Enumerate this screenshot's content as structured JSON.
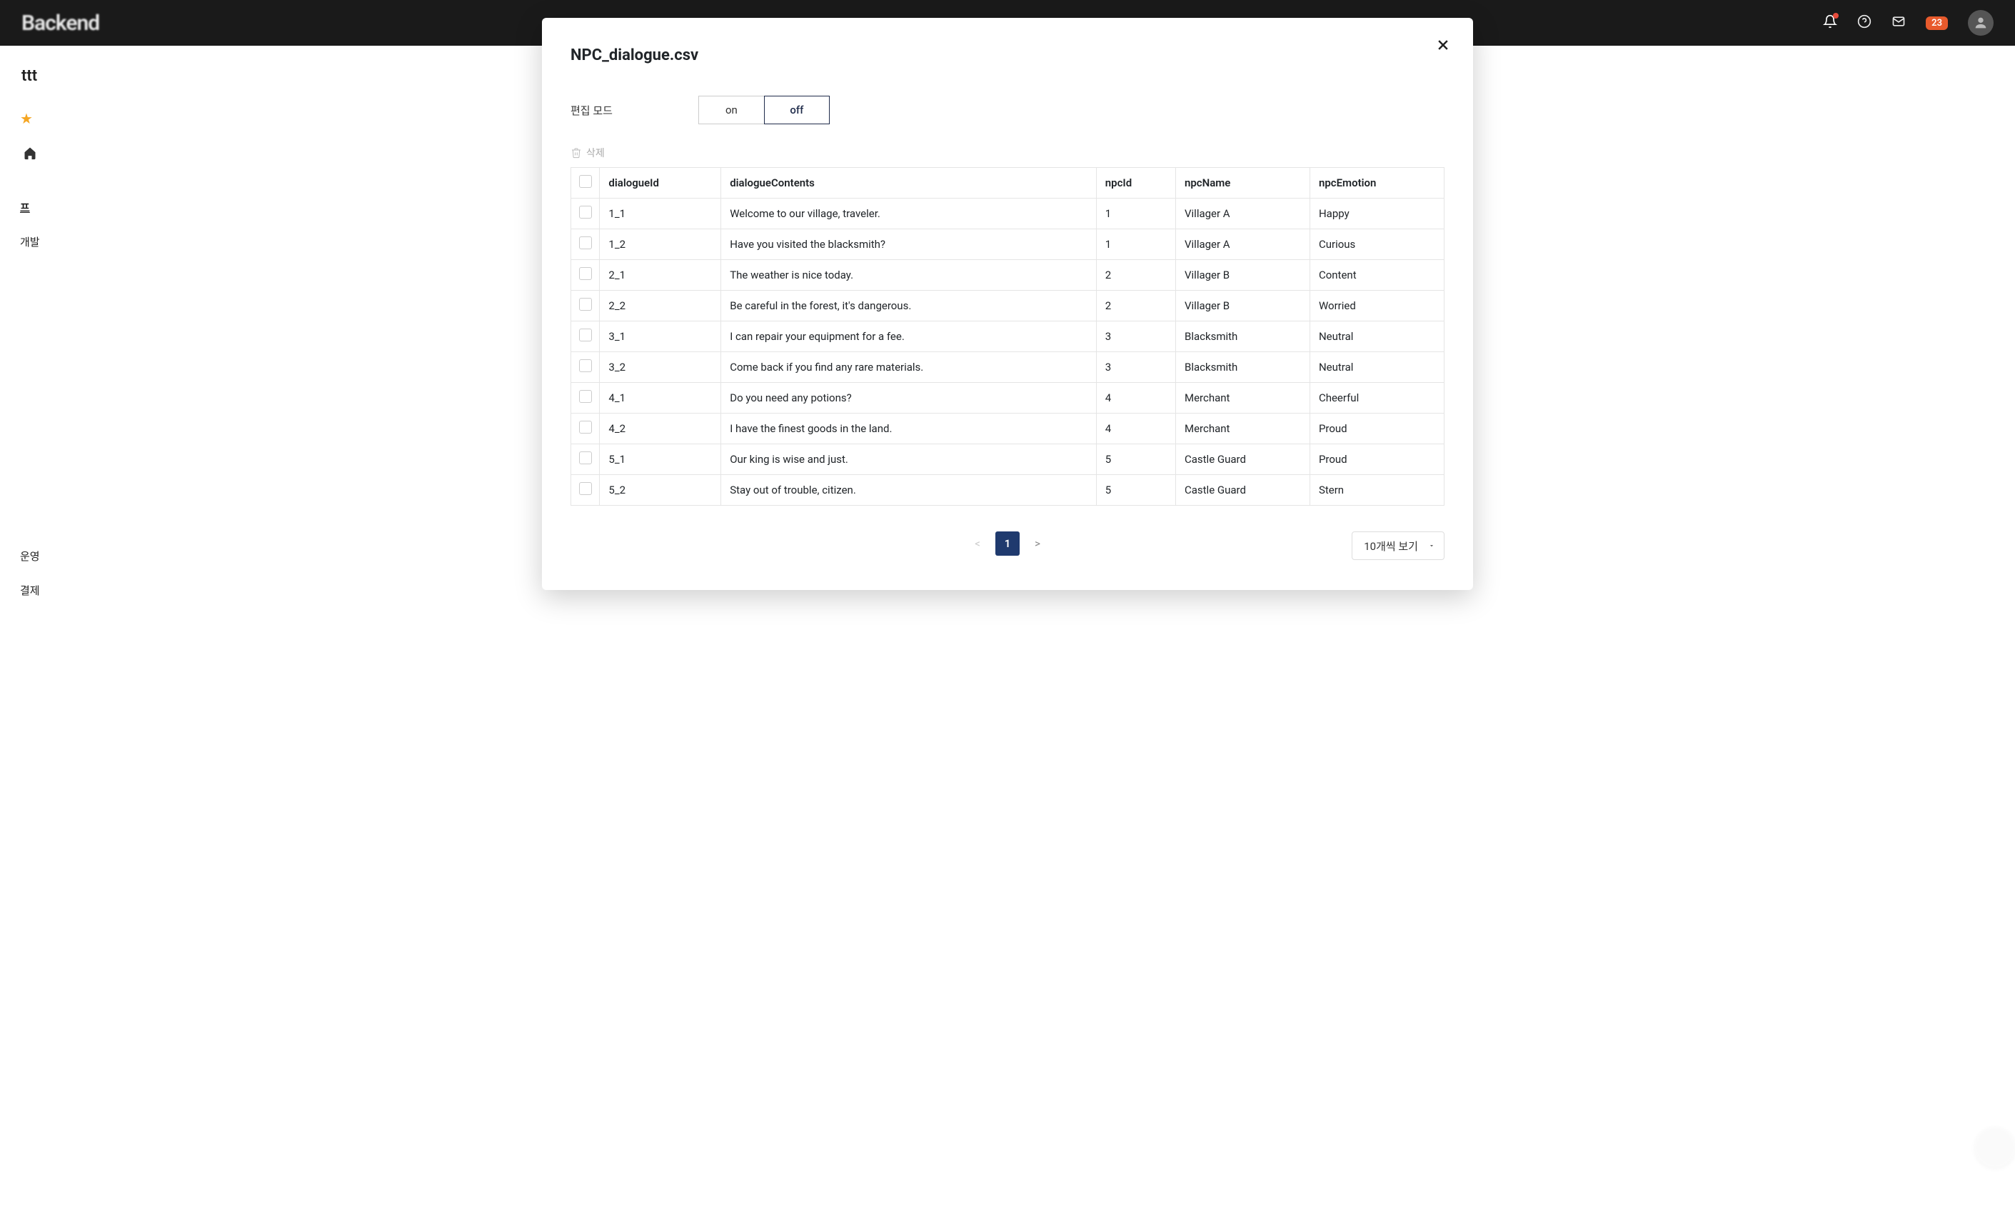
{
  "background": {
    "logo": "Backend",
    "page_title_prefix": "ttt",
    "badge_count": "23",
    "side_labels": [
      "프",
      "개발",
      "운영",
      "결제"
    ]
  },
  "modal": {
    "title": "NPC_dialogue.csv",
    "edit_mode_label": "편집 모드",
    "toggle_on": "on",
    "toggle_off": "off",
    "delete_label": "삭제",
    "columns": {
      "dialogueId": "dialogueId",
      "dialogueContents": "dialogueContents",
      "npcId": "npcId",
      "npcName": "npcName",
      "npcEmotion": "npcEmotion"
    },
    "rows": [
      {
        "dialogueId": "1_1",
        "dialogueContents": "Welcome to our village, traveler.",
        "npcId": "1",
        "npcName": "Villager A",
        "npcEmotion": "Happy"
      },
      {
        "dialogueId": "1_2",
        "dialogueContents": "Have you visited the blacksmith?",
        "npcId": "1",
        "npcName": "Villager A",
        "npcEmotion": "Curious"
      },
      {
        "dialogueId": "2_1",
        "dialogueContents": "The weather is nice today.",
        "npcId": "2",
        "npcName": "Villager B",
        "npcEmotion": "Content"
      },
      {
        "dialogueId": "2_2",
        "dialogueContents": "Be careful in the forest, it's dangerous.",
        "npcId": "2",
        "npcName": "Villager B",
        "npcEmotion": "Worried"
      },
      {
        "dialogueId": "3_1",
        "dialogueContents": "I can repair your equipment for a fee.",
        "npcId": "3",
        "npcName": "Blacksmith",
        "npcEmotion": "Neutral"
      },
      {
        "dialogueId": "3_2",
        "dialogueContents": "Come back if you find any rare materials.",
        "npcId": "3",
        "npcName": "Blacksmith",
        "npcEmotion": "Neutral"
      },
      {
        "dialogueId": "4_1",
        "dialogueContents": "Do you need any potions?",
        "npcId": "4",
        "npcName": "Merchant",
        "npcEmotion": "Cheerful"
      },
      {
        "dialogueId": "4_2",
        "dialogueContents": "I have the finest goods in the land.",
        "npcId": "4",
        "npcName": "Merchant",
        "npcEmotion": "Proud"
      },
      {
        "dialogueId": "5_1",
        "dialogueContents": "Our king is wise and just.",
        "npcId": "5",
        "npcName": "Castle Guard",
        "npcEmotion": "Proud"
      },
      {
        "dialogueId": "5_2",
        "dialogueContents": "Stay out of trouble, citizen.",
        "npcId": "5",
        "npcName": "Castle Guard",
        "npcEmotion": "Stern"
      }
    ],
    "pager": {
      "prev": "<",
      "current": "1",
      "next": ">"
    },
    "page_size_label": "10개씩 보기"
  }
}
